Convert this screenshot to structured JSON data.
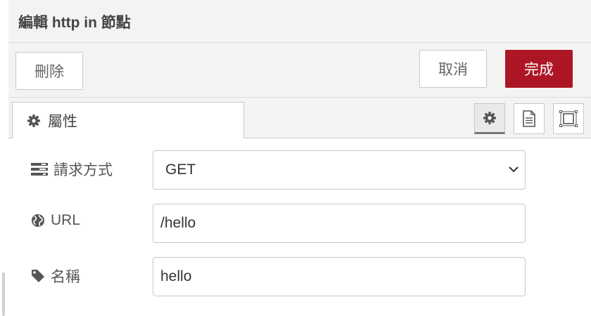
{
  "dialog": {
    "title": "編輯 http in 節點"
  },
  "toolbar": {
    "delete_label": "刪除",
    "cancel_label": "取消",
    "done_label": "完成"
  },
  "tabs": {
    "properties_label": "屬性",
    "icons": [
      "gear-icon",
      "description-icon",
      "appearance-icon"
    ]
  },
  "form": {
    "method": {
      "label": "請求方式",
      "value": "GET",
      "icon": "tasks-icon"
    },
    "url": {
      "label": "URL",
      "value": "/hello",
      "icon": "globe-icon"
    },
    "name": {
      "label": "名稱",
      "value": "hello",
      "icon": "tag-icon"
    }
  },
  "colors": {
    "done_button": "#ad1625",
    "background": "#f3f3f3"
  }
}
